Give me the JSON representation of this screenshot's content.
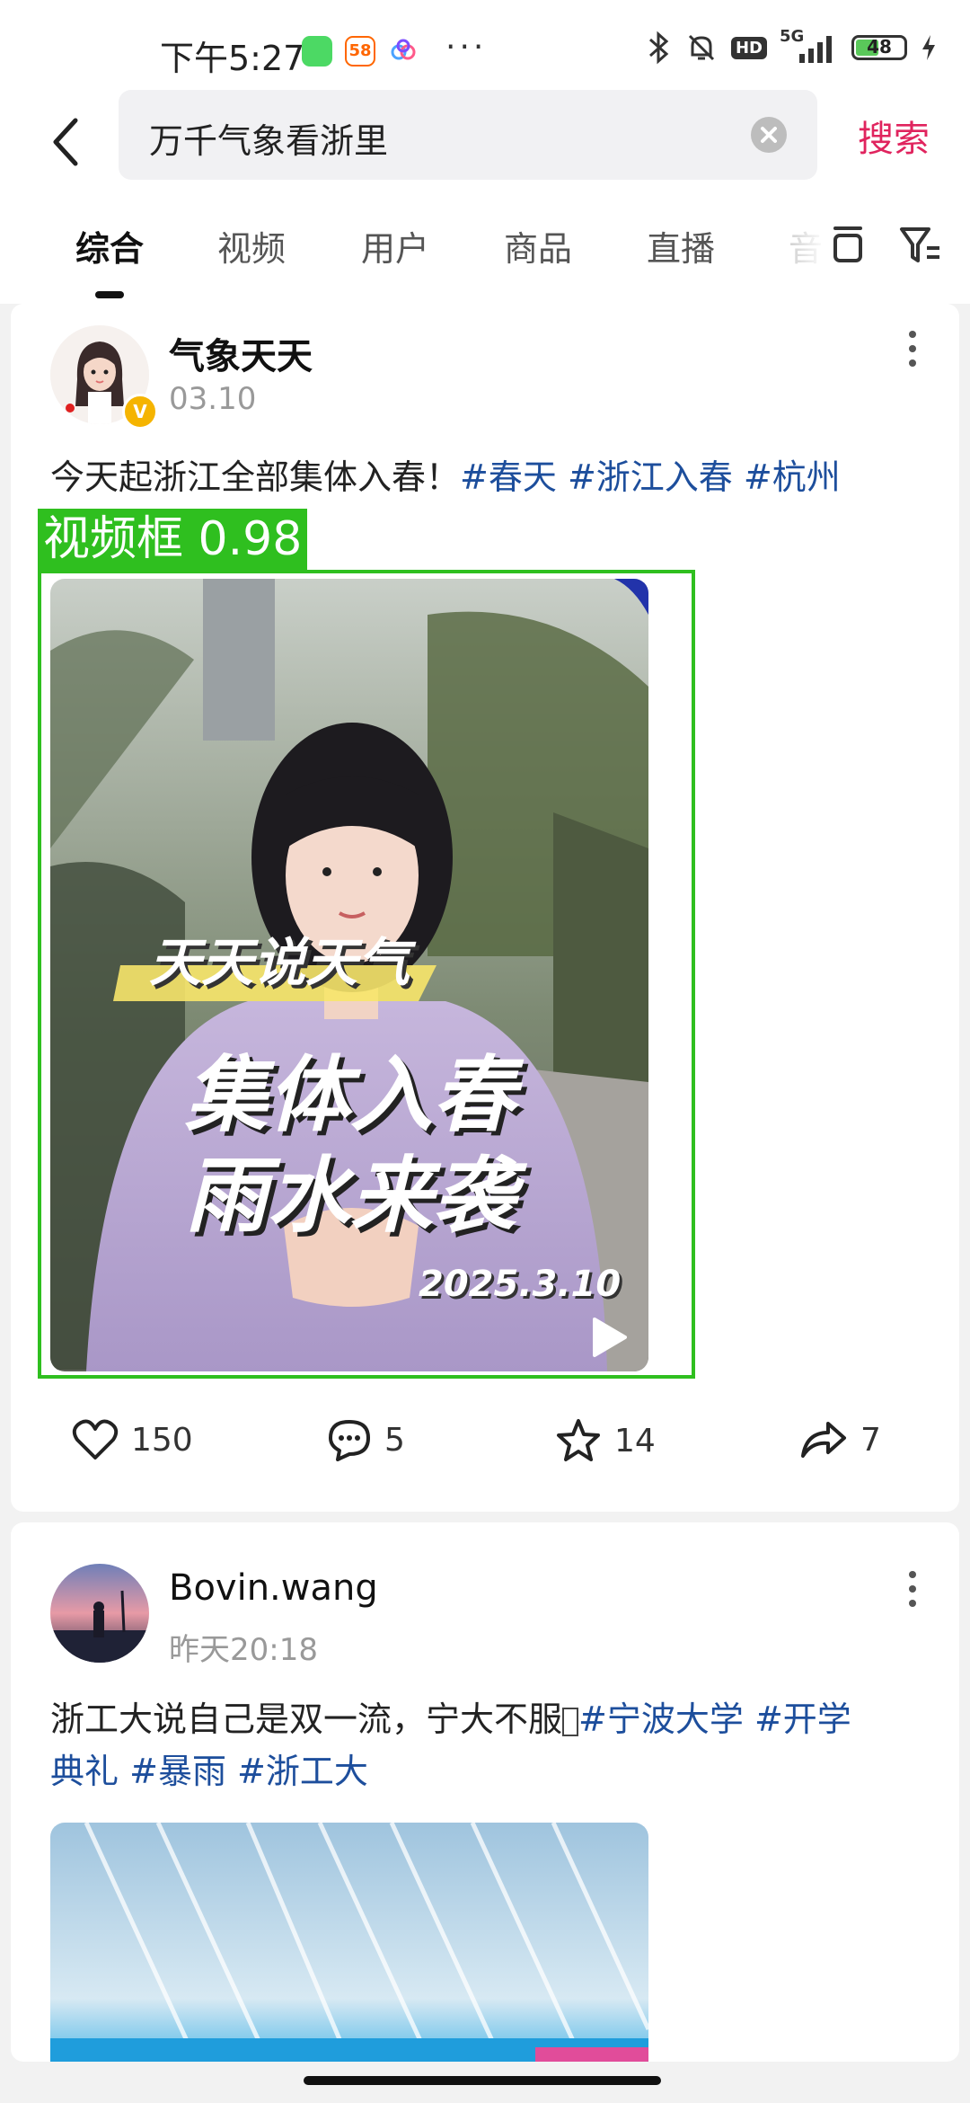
{
  "status_bar": {
    "time": "下午5:27",
    "app_badge_58": "58",
    "more_dots": "···",
    "hd": "HD",
    "network": "5G",
    "battery": "48",
    "battery_level": 0.48
  },
  "header": {
    "search_value": "万千气象看浙里",
    "search_button": "搜索"
  },
  "tabs": [
    "综合",
    "视频",
    "用户",
    "商品",
    "直播",
    "音"
  ],
  "active_tab": 0,
  "posts": [
    {
      "username": "气象天天",
      "date": "03.10",
      "text": "今天起浙江全部集体入春！",
      "tags": [
        "#春天",
        "#浙江入春",
        "#杭州"
      ],
      "detection_label": "视频框 0.98",
      "video_overlay": {
        "banner": "天天说天气",
        "headline_1": "集体入春",
        "headline_2": "雨水来袭",
        "date": "2025.3.10"
      },
      "actions": {
        "likes": "150",
        "comments": "5",
        "favorites": "14",
        "shares": "7"
      }
    },
    {
      "username": "Bovin.wang",
      "date": "昨天20:18",
      "text": "浙工大说自己是双一流，宁大不服",
      "tags": [
        "#宁波大学",
        "#开学",
        "典礼",
        "#暴雨",
        "#浙工大"
      ]
    }
  ],
  "colors": {
    "accent": "#e0245e",
    "tag": "#1d4e9c",
    "detection": "#2fbf1f"
  }
}
